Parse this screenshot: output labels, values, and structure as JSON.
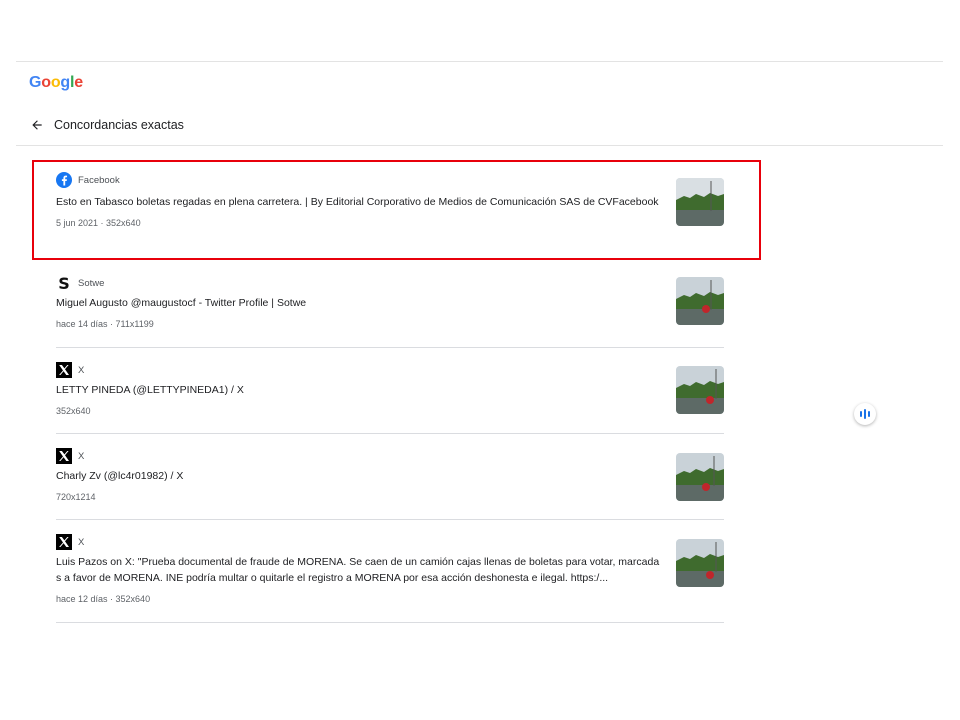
{
  "logo": {
    "letters": [
      "G",
      "o",
      "o",
      "g",
      "l",
      "e"
    ],
    "colors": [
      "#4285F4",
      "#EA4335",
      "#FBBC05",
      "#4285F4",
      "#34A853",
      "#EA4335"
    ]
  },
  "header": {
    "back_icon": "arrow-left-icon",
    "title": "Concordancias exactas"
  },
  "results": [
    {
      "source": "Facebook",
      "icon": "facebook-icon",
      "title": "Esto en Tabasco boletas regadas en plena carretera. | By Editorial Corporativo de Medios de Comunicación SAS de CVFacebook",
      "meta": "5 jun 2021 · 352x640",
      "highlighted": true
    },
    {
      "source": "Sotwe",
      "icon": "sotwe-icon",
      "title": "Miguel Augusto @maugustocf - Twitter Profile | Sotwe",
      "meta": "hace 14 días · 711x1199",
      "highlighted": false
    },
    {
      "source": "X",
      "icon": "x-icon",
      "title": "LETTY PINEDA (@LETTYPINEDA1) / X",
      "meta": "352x640",
      "highlighted": false
    },
    {
      "source": "X",
      "icon": "x-icon",
      "title": "Charly Zv (@lc4r01982) / X",
      "meta": "720x1214",
      "highlighted": false
    },
    {
      "source": "X",
      "icon": "x-icon",
      "title": "Luis Pazos on X: \"Prueba documental de fraude de MORENA. Se caen de un camión cajas llenas de boletas para votar, marcadas a favor de MORENA. INE podría multar o quitarle el registro a MORENA por esa acción deshonesta e ilegal. https:/...",
      "meta": "hace 12 días · 352x640",
      "highlighted": false
    }
  ],
  "voice_button": {
    "icon": "voice-bars-icon",
    "color": "#1a73e8"
  },
  "highlight_color": "#e8000b"
}
